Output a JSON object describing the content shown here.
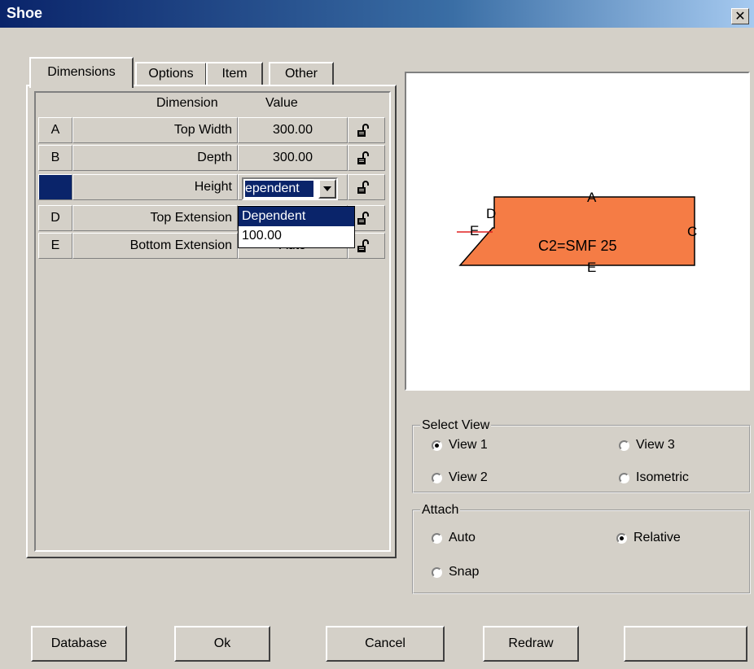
{
  "window": {
    "title": "Shoe"
  },
  "tabs": [
    {
      "label": "Dimensions"
    },
    {
      "label": "Options"
    },
    {
      "label": "Item"
    },
    {
      "label": "Other"
    }
  ],
  "grid": {
    "headers": {
      "dimension": "Dimension",
      "value": "Value"
    },
    "rows": [
      {
        "letter": "A",
        "dimension": "Top Width",
        "value": "300.00"
      },
      {
        "letter": "B",
        "dimension": "Depth",
        "value": "300.00"
      },
      {
        "letter": "",
        "dimension": "Height",
        "value": "ependent"
      },
      {
        "letter": "D",
        "dimension": "Top Extension",
        "value": ""
      },
      {
        "letter": "E",
        "dimension": "Bottom Extension",
        "value": "Auto"
      }
    ],
    "dropdown_options": [
      "Dependent",
      "100.00"
    ]
  },
  "preview": {
    "labels": {
      "a": "A",
      "c": "C",
      "d": "D",
      "e_left": "E",
      "e_bottom": "E"
    },
    "caption": "C2=SMF 25",
    "fill_color": "#f57c45"
  },
  "select_view": {
    "legend": "Select View",
    "options": [
      "View 1",
      "View 3",
      "View 2",
      "Isometric"
    ],
    "selected": "View 1"
  },
  "attach": {
    "legend": "Attach",
    "options": [
      "Auto",
      "Relative",
      "Snap"
    ],
    "selected": "Relative"
  },
  "buttons": {
    "database": "Database",
    "ok": "Ok",
    "cancel": "Cancel",
    "redraw": "Redraw",
    "blank": ""
  }
}
